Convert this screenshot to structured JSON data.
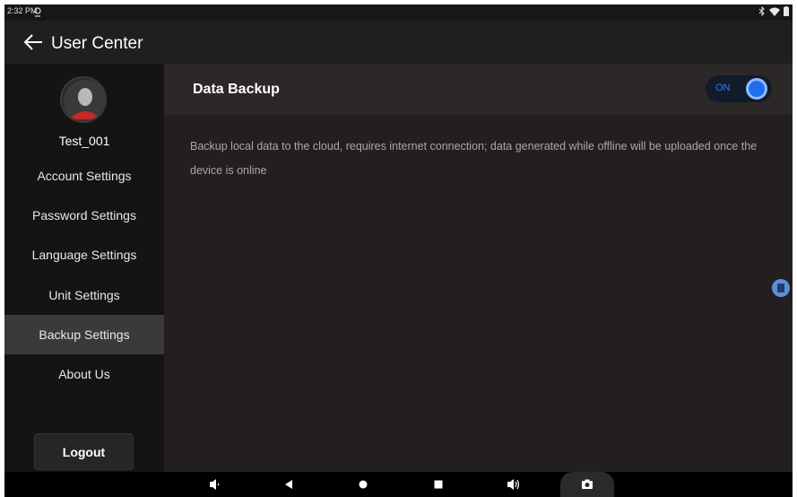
{
  "status_bar": {
    "time": "2:32 PM",
    "icons": [
      "location-icon",
      "bluetooth-icon",
      "wifi-icon",
      "battery-icon"
    ]
  },
  "header": {
    "title": "User Center",
    "back_icon": "arrow-left-icon"
  },
  "sidebar": {
    "username": "Test_001",
    "items": [
      {
        "label": "Account Settings",
        "active": false
      },
      {
        "label": "Password Settings",
        "active": false
      },
      {
        "label": "Language Settings",
        "active": false
      },
      {
        "label": "Unit Settings",
        "active": false
      },
      {
        "label": "Backup Settings",
        "active": true
      },
      {
        "label": "About Us",
        "active": false
      }
    ],
    "logout_label": "Logout"
  },
  "content": {
    "title": "Data Backup",
    "toggle": {
      "label": "ON",
      "state": true
    },
    "description": "Backup local data to the cloud, requires internet connection; data generated while offline will be uploaded once the device is online"
  },
  "nav_bar": {
    "buttons": [
      "volume-down-icon",
      "back-triangle-icon",
      "home-circle-icon",
      "recents-square-icon",
      "volume-up-icon",
      "camera-icon"
    ]
  },
  "colors": {
    "accent": "#1f6ef0",
    "active_item_bg": "#3a3a3a",
    "sidebar_bg": "#141414",
    "content_bg": "#241f1f"
  }
}
